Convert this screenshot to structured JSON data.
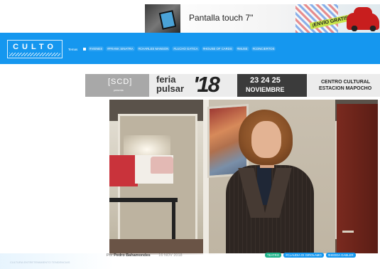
{
  "top_ad": {
    "headline": "Pantalla touch 7\"",
    "badge": "¡ENVÍO GRATIS!"
  },
  "header": {
    "logo_text": "CULTO",
    "temas_label": "Temas",
    "tags": [
      "#VIENES",
      "#FRANK SINATRA",
      "#CHARLES MANSON",
      "#LUCHO GATICA",
      "#HOUSE OF CARDS",
      "#MUSE",
      "#CONCIERTOS"
    ]
  },
  "feria_banner": {
    "scd": "[SCD]",
    "presenta": "presenta",
    "feria": "feria",
    "pulsar": "pulsar",
    "edition": "'18",
    "days": "23 24 25",
    "month": "NOVIEMBRE",
    "venue_line1": "CENTRO CULTURAL",
    "venue_line2": "ESTACION MAPOCHO"
  },
  "article": {
    "byline_prefix": "Por",
    "author": "Pedro Bahamondes",
    "date": "16 NOV 2018",
    "tags": [
      "TEATRO",
      "#CLAUDIA DI GIROLAMO",
      "#HEDDA GABLER"
    ],
    "faint_text": "CULTURA ENTRETENIMIENTO TENDENCIAS"
  },
  "colors": {
    "header_blue": "#1597ef",
    "tag_green": "#1fb38a"
  }
}
